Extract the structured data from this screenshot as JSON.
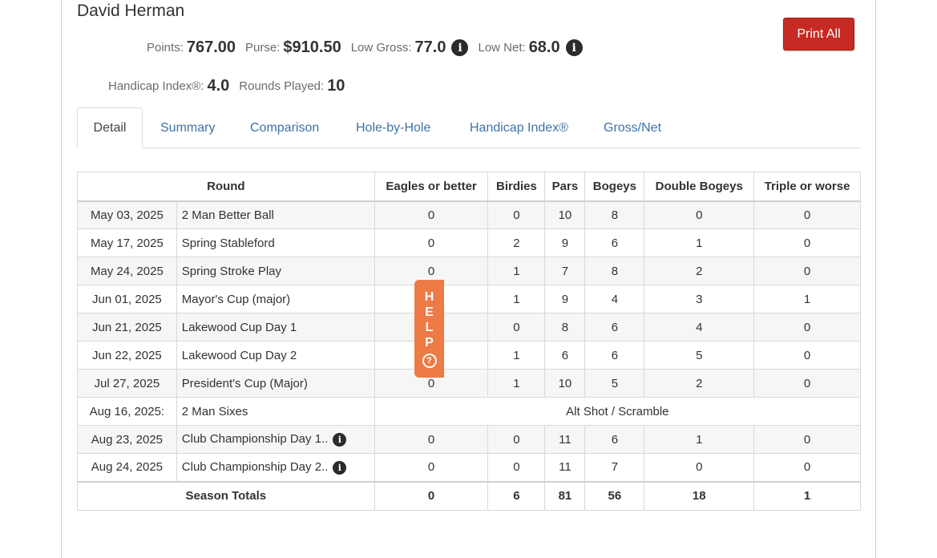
{
  "player": {
    "name": "David Herman"
  },
  "actions": {
    "print_all": "Print All"
  },
  "stats": {
    "points_label": "Points:",
    "points_value": "767.00",
    "purse_label": "Purse:",
    "purse_value": "$910.50",
    "low_gross_label": "Low Gross:",
    "low_gross_value": "77.0",
    "low_net_label": "Low Net:",
    "low_net_value": "68.0",
    "handicap_label": "Handicap Index®:",
    "handicap_value": "4.0",
    "rounds_label": "Rounds Played:",
    "rounds_value": "10"
  },
  "tabs": [
    {
      "label": "Detail",
      "active": true
    },
    {
      "label": "Summary"
    },
    {
      "label": "Comparison"
    },
    {
      "label": "Hole-by-Hole"
    },
    {
      "label": "Handicap Index®"
    },
    {
      "label": "Gross/Net"
    }
  ],
  "table": {
    "headers": [
      "Round",
      "Eagles or better",
      "Birdies",
      "Pars",
      "Bogeys",
      "Double Bogeys",
      "Triple or worse"
    ],
    "rows": [
      {
        "date": "May 03, 2025",
        "round": "2 Man Better Ball",
        "eagles": "0",
        "birdies": "0",
        "pars": "10",
        "bogeys": "8",
        "doubles": "0",
        "triples": "0"
      },
      {
        "date": "May 17, 2025",
        "round": "Spring Stableford",
        "eagles": "0",
        "birdies": "2",
        "pars": "9",
        "bogeys": "6",
        "doubles": "1",
        "triples": "0"
      },
      {
        "date": "May 24, 2025",
        "round": "Spring Stroke Play",
        "eagles": "0",
        "birdies": "1",
        "pars": "7",
        "bogeys": "8",
        "doubles": "2",
        "triples": "0"
      },
      {
        "date": "Jun 01, 2025",
        "round": "Mayor's Cup (major)",
        "eagles": "",
        "birdies": "1",
        "pars": "9",
        "bogeys": "4",
        "doubles": "3",
        "triples": "1"
      },
      {
        "date": "Jun 21, 2025",
        "round": "Lakewood Cup Day 1",
        "eagles": "",
        "birdies": "0",
        "pars": "8",
        "bogeys": "6",
        "doubles": "4",
        "triples": "0"
      },
      {
        "date": "Jun 22, 2025",
        "round": "Lakewood Cup Day 2",
        "eagles": "",
        "birdies": "1",
        "pars": "6",
        "bogeys": "6",
        "doubles": "5",
        "triples": "0"
      },
      {
        "date": "Jul 27, 2025",
        "round": "President's Cup (Major)",
        "eagles": "0",
        "birdies": "1",
        "pars": "10",
        "bogeys": "5",
        "doubles": "2",
        "triples": "0"
      },
      {
        "date": "Aug 16, 2025:",
        "round": "2 Man Sixes",
        "note": "Alt Shot / Scramble"
      },
      {
        "date": "Aug 23, 2025",
        "round": "Club Championship Day 1..",
        "info": true,
        "eagles": "0",
        "birdies": "0",
        "pars": "11",
        "bogeys": "6",
        "doubles": "1",
        "triples": "0"
      },
      {
        "date": "Aug 24, 2025",
        "round": "Club Championship Day 2..",
        "info": true,
        "eagles": "0",
        "birdies": "0",
        "pars": "11",
        "bogeys": "7",
        "doubles": "0",
        "triples": "0"
      }
    ],
    "totals": {
      "label": "Season Totals",
      "eagles": "0",
      "birdies": "6",
      "pars": "81",
      "bogeys": "56",
      "doubles": "18",
      "triples": "1"
    }
  },
  "help": {
    "letters": [
      "H",
      "E",
      "L",
      "P"
    ],
    "icon": "question-circle-icon"
  },
  "colors": {
    "accent": "#c62a22",
    "link": "#3f72a8",
    "help": "#ee7a45"
  }
}
